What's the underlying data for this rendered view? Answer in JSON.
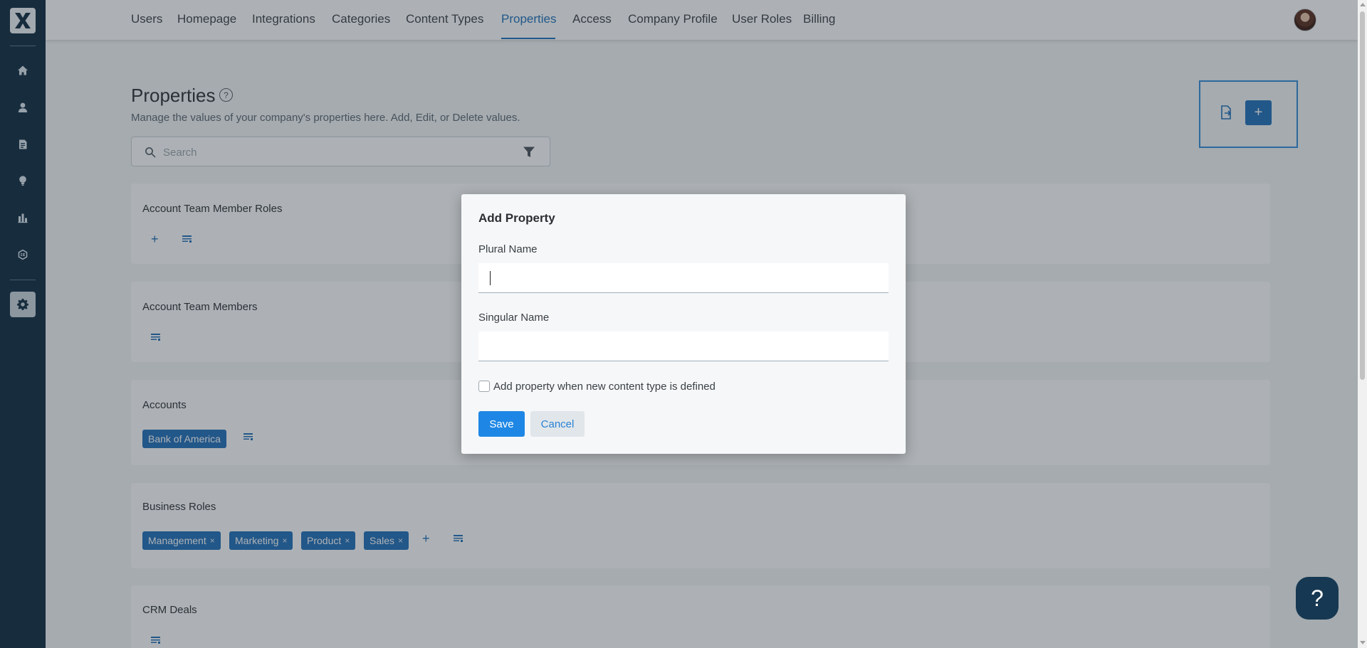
{
  "app": {
    "logo_letter": "X",
    "accent_color": "#1f6fb8",
    "sidebar_color": "#0e2a40"
  },
  "sidebar": {
    "items": [
      {
        "icon": "home-icon"
      },
      {
        "icon": "user-icon"
      },
      {
        "icon": "document-icon"
      },
      {
        "icon": "lightbulb-icon"
      },
      {
        "icon": "bar-chart-icon"
      },
      {
        "icon": "ce-badge-icon"
      },
      {
        "icon": "gear-icon",
        "active": true
      }
    ]
  },
  "topnav": {
    "tabs": [
      {
        "label": "Users"
      },
      {
        "label": "Homepage"
      },
      {
        "label": "Integrations"
      },
      {
        "label": "Categories"
      },
      {
        "label": "Content Types"
      },
      {
        "label": "Properties",
        "active": true
      },
      {
        "label": "Access"
      },
      {
        "label": "Company Profile"
      },
      {
        "label": "User Roles"
      },
      {
        "label": "Billing"
      }
    ]
  },
  "page": {
    "title": "Properties",
    "help_glyph": "?",
    "description": "Manage the values of your company's properties here. Add, Edit, or Delete values.",
    "search_placeholder": "Search",
    "add_button_glyph": "+"
  },
  "properties": [
    {
      "name": "Account Team Member Roles",
      "values": [],
      "has_add": true
    },
    {
      "name": "Account Team Members",
      "values": [],
      "has_add": false
    },
    {
      "name": "Accounts",
      "values": [
        "Bank of America"
      ],
      "has_add": false
    },
    {
      "name": "Business Roles",
      "values": [
        "Management",
        "Marketing",
        "Product",
        "Sales"
      ],
      "has_add": true
    },
    {
      "name": "CRM Deals",
      "values": [],
      "has_add": false
    }
  ],
  "chip_remove_glyph": "×",
  "card_add_glyph": "+",
  "modal": {
    "title": "Add Property",
    "plural_label": "Plural Name",
    "plural_value": "",
    "singular_label": "Singular Name",
    "singular_value": "",
    "checkbox_label": "Add property when new content type is defined",
    "checkbox_checked": false,
    "save_label": "Save",
    "cancel_label": "Cancel"
  },
  "help_fab_glyph": "?"
}
